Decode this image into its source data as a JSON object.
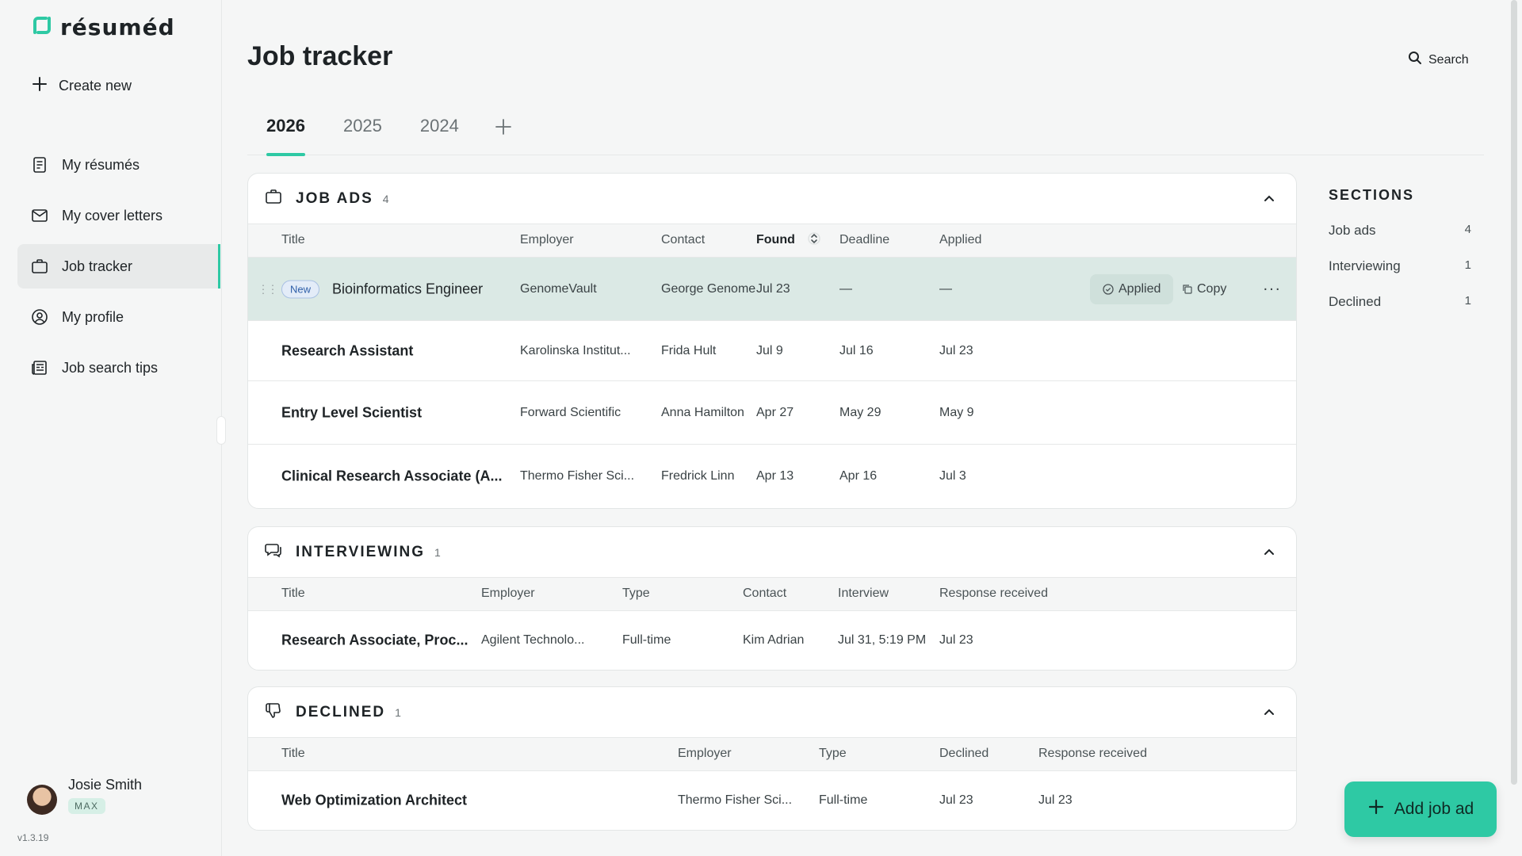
{
  "brand": {
    "name": "résuméd"
  },
  "sidebar": {
    "create_new": "Create new",
    "items": [
      {
        "label": "My résumés",
        "icon": "document-icon"
      },
      {
        "label": "My cover letters",
        "icon": "envelope-icon"
      },
      {
        "label": "Job tracker",
        "icon": "briefcase-icon"
      },
      {
        "label": "My profile",
        "icon": "user-circle-icon"
      },
      {
        "label": "Job search tips",
        "icon": "newspaper-icon"
      }
    ],
    "active_item": "Job tracker",
    "user": {
      "name": "Josie Smith",
      "plan": "MAX"
    },
    "version": "v1.3.19"
  },
  "header": {
    "title": "Job tracker",
    "search_label": "Search"
  },
  "tabs": [
    "2026",
    "2025",
    "2024"
  ],
  "active_tab": "2026",
  "job_ads": {
    "title": "JOB ADS",
    "count": "4",
    "columns": [
      "Title",
      "Employer",
      "Contact",
      "Found",
      "Deadline",
      "Applied"
    ],
    "rows": [
      {
        "badge": "New",
        "title": "Bioinformatics Engineer",
        "employer": "GenomeVault",
        "contact": "George Genome",
        "found": "Jul 23",
        "deadline": "—",
        "applied": "—",
        "applied_btn": "Applied",
        "copy_btn": "Copy",
        "more": "···"
      },
      {
        "title": "Research Assistant",
        "employer": "Karolinska Institut...",
        "contact": "Frida Hult",
        "found": "Jul 9",
        "deadline": "Jul 16",
        "applied": "Jul 23"
      },
      {
        "title": "Entry Level Scientist",
        "employer": "Forward Scientific",
        "contact": "Anna Hamilton",
        "found": "Apr 27",
        "deadline": "May 29",
        "applied": "May 9"
      },
      {
        "title": "Clinical Research Associate (A...",
        "employer": "Thermo Fisher Sci...",
        "contact": "Fredrick Linn",
        "found": "Apr 13",
        "deadline": "Apr 16",
        "applied": "Jul 3"
      }
    ]
  },
  "interviewing": {
    "title": "INTERVIEWING",
    "count": "1",
    "columns": [
      "Title",
      "Employer",
      "Type",
      "Contact",
      "Interview",
      "Response received"
    ],
    "rows": [
      {
        "title": "Research Associate, Proc...",
        "employer": "Agilent Technolo...",
        "type": "Full-time",
        "contact": "Kim Adrian",
        "interview": "Jul 31, 5:19 PM",
        "response": "Jul 23"
      }
    ]
  },
  "declined": {
    "title": "DECLINED",
    "count": "1",
    "columns": [
      "Title",
      "Employer",
      "Type",
      "Declined",
      "Response received"
    ],
    "rows": [
      {
        "title": "Web Optimization Architect",
        "employer": "Thermo Fisher Sci...",
        "type": "Full-time",
        "declined": "Jul 23",
        "response": "Jul 23"
      }
    ]
  },
  "sections_panel": {
    "title": "SECTIONS",
    "items": [
      {
        "label": "Job ads",
        "count": "4"
      },
      {
        "label": "Interviewing",
        "count": "1"
      },
      {
        "label": "Declined",
        "count": "1"
      }
    ]
  },
  "add_job_label": "Add job ad",
  "colors": {
    "accent": "#2ec9a4",
    "highlight_row": "#dbe9e5",
    "background": "#f5f6f6"
  }
}
